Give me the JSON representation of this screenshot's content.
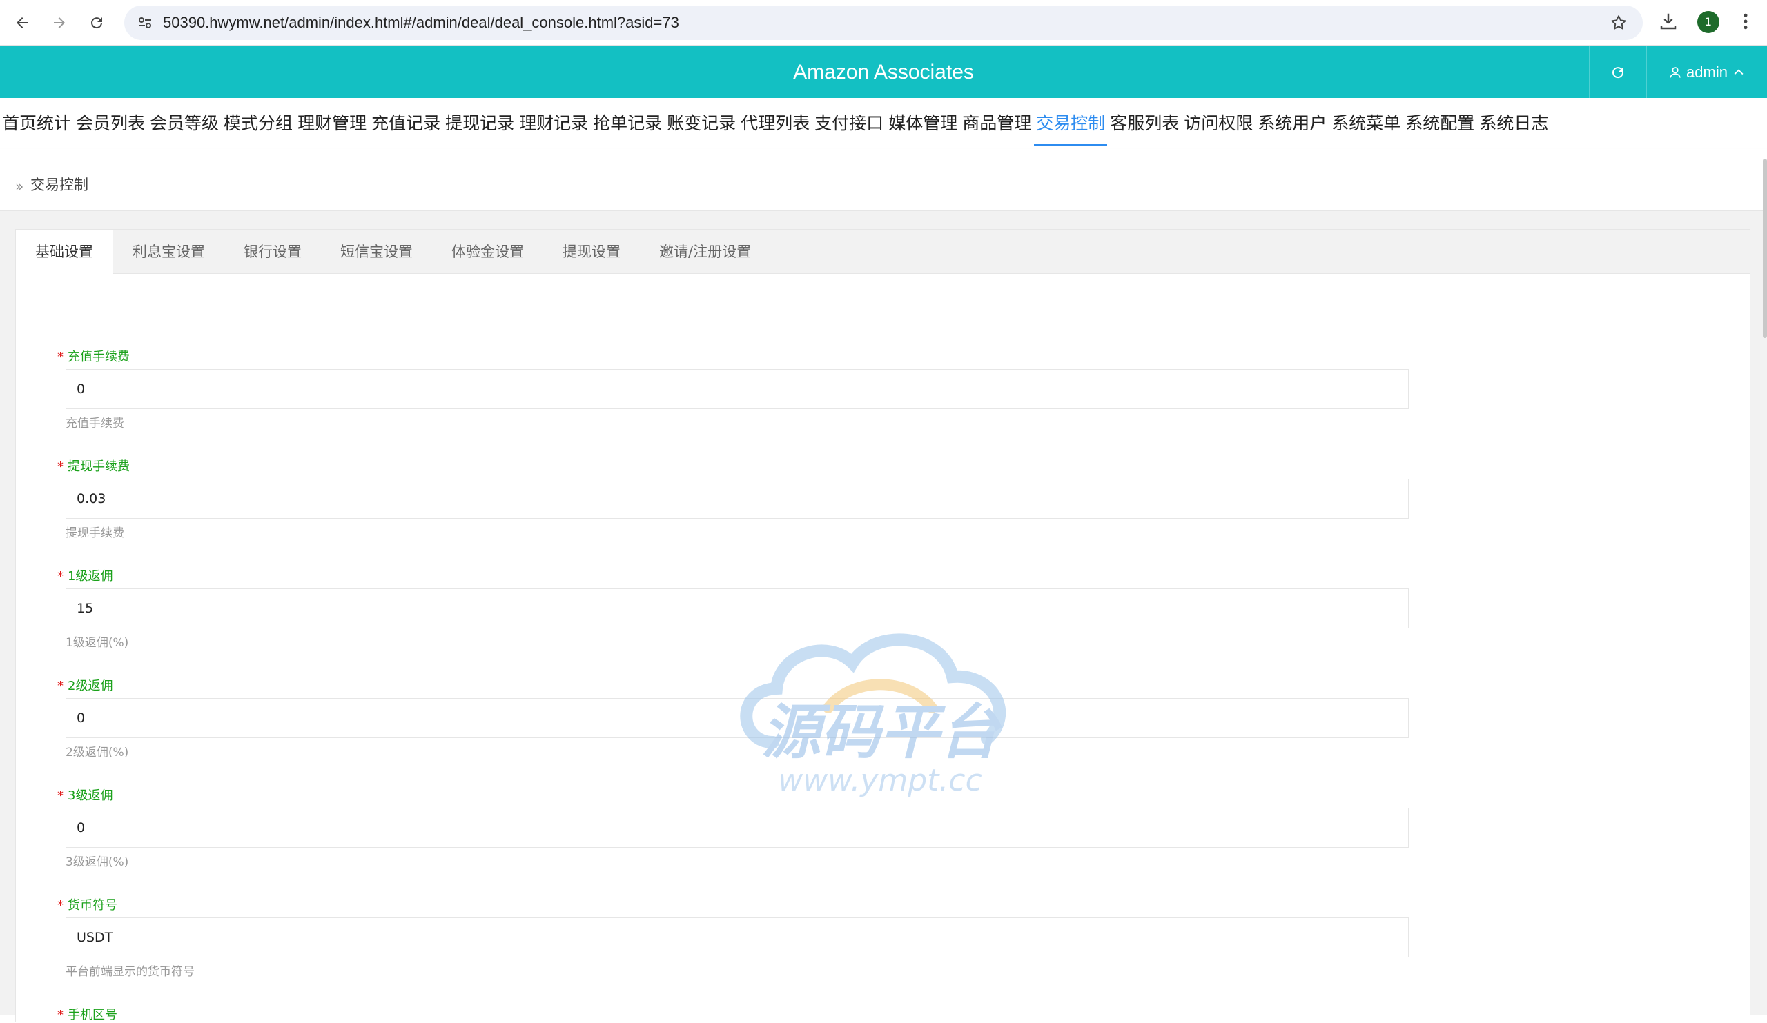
{
  "browser": {
    "url": "50390.hwymw.net/admin/index.html#/admin/deal/deal_console.html?asid=73",
    "profile_badge": "1"
  },
  "header": {
    "title": "Amazon Associates",
    "user": "admin"
  },
  "nav": {
    "items": [
      "首页统计",
      "会员列表",
      "会员等级",
      "模式分组",
      "理财管理",
      "充值记录",
      "提现记录",
      "理财记录",
      "抢单记录",
      "账变记录",
      "代理列表",
      "支付接口",
      "媒体管理",
      "商品管理",
      "交易控制",
      "客服列表",
      "访问权限",
      "系统用户",
      "系统菜单",
      "系统配置",
      "系统日志"
    ],
    "active_index": 14
  },
  "breadcrumb": {
    "current": "交易控制"
  },
  "tabs": {
    "items": [
      "基础设置",
      "利息宝设置",
      "银行设置",
      "短信宝设置",
      "体验金设置",
      "提现设置",
      "邀请/注册设置"
    ],
    "active_index": 0
  },
  "form": {
    "required_mark": "*",
    "fields": [
      {
        "label": "充值手续费",
        "value": "0",
        "help": "充值手续费"
      },
      {
        "label": "提现手续费",
        "value": "0.03",
        "help": "提现手续费"
      },
      {
        "label": "1级返佣",
        "value": "15",
        "help": "1级返佣(%)"
      },
      {
        "label": "2级返佣",
        "value": "0",
        "help": "2级返佣(%)"
      },
      {
        "label": "3级返佣",
        "value": "0",
        "help": "3级返佣(%)"
      },
      {
        "label": "货币符号",
        "value": "USDT",
        "help": "平台前端显示的货币符号"
      },
      {
        "label": "手机区号",
        "value": "",
        "help": ""
      }
    ]
  },
  "watermark": {
    "text": "源码平台",
    "url": "www.ympt.cc"
  },
  "colors": {
    "header_bg": "#13c0c3",
    "nav_active": "#2d8cf0",
    "label_green": "#1aa11a",
    "required_red": "#e02020"
  }
}
